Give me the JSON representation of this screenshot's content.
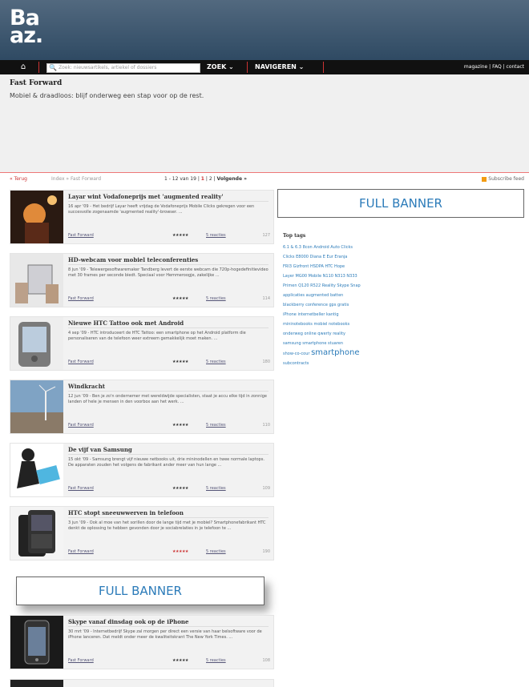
{
  "logo": {
    "line1": "Ba",
    "line2": "az."
  },
  "nav": {
    "search_placeholder": "Zoek: nieuwsartikels, artiekel of dossiers",
    "zoek_label": "ZOEK ⌄",
    "navigeren_label": "NAVIGEREN ⌄",
    "top_links": "magazine | FAQ | contact"
  },
  "intro": {
    "title": "Fast Forward",
    "subtitle": "Mobiel & draadloos: blijf onderweg een stap voor op de rest."
  },
  "crumbs": {
    "back": "« Terug",
    "path": "Index » Fast Forward",
    "pager_range": "1 - 12 van 19",
    "page1": "1",
    "page2": "2",
    "next": "Volgende »",
    "rss": "Subscribe feed"
  },
  "banners": {
    "right": "FULL BANNER",
    "mid": "FULL BANNER"
  },
  "articles": [
    {
      "title": "Layar wint Vodafoneprijs met 'augmented reality'",
      "desc": "16 apr '09 - Het bedrijf Layar heeft vrijdag de Vodafoneprijs Mobile Clicks gekregen voor een succesvolle zogenaamde 'augmented reality'-browser. ...",
      "tag": "Fast Forward",
      "stars": "★★★★★",
      "reactions": "5 reacties",
      "views": "127"
    },
    {
      "title": "HD-webcam voor mobiel teleconferenties",
      "desc": "8 jun '09 - Telewergesoftwaremaker Tandberg levert de eerste webcam die 720p-hogedefinitievideo met 30 frames per seconde biedt. Speciaal voor Hemmeroogje, zakelijke ...",
      "tag": "Fast Forward",
      "stars": "★★★★★",
      "reactions": "5 reacties",
      "views": "114"
    },
    {
      "title": "Nieuwe HTC Tattoo ook met Android",
      "desc": "4 sep '09 - HTC introduceert de HTC Tattoo: een smartphone op het Android platform die personaliseren van de telefoon weer extreem gemakkelijk moet maken. ...",
      "tag": "Fast Forward",
      "stars": "★★★★★",
      "reactions": "5 reacties",
      "views": "180"
    },
    {
      "title": "Windkracht",
      "desc": "12 jun '09 - Ben je zo'n ondernemer met wereldwijde specialisten, staat je accu elke tijd in zonnige landen of hele je mensen in den voorbox aan het werk. ...",
      "tag": "Fast Forward",
      "stars": "★★★★★",
      "reactions": "5 reacties",
      "views": "110"
    },
    {
      "title": "De vijf van Samsung",
      "desc": "15 okt '09 - Samsung brengt vijf nieuwe netbooks uit, drie mininodellen en twee normale laptops. De apparaten zouden het volgens de fabrikant ander meer van hun lange ...",
      "tag": "Fast Forward",
      "stars": "★★★★★",
      "reactions": "5 reacties",
      "views": "109"
    },
    {
      "title": "HTC stopt sneeuwwerven in telefoon",
      "desc": "3 jun '09 - Ook al moe van het sorillen door de lange tijd met je mobiel? Smartphonefabrikant HTC denkt de oplossing te hebben gevonden door je sociabrelaties in je telefoon te ...",
      "tag": "Fast Forward",
      "stars": "★★★★★",
      "reactions": "5 reacties",
      "views": "190"
    },
    {
      "title": "Skype vanaf dinsdag ook op de iPhone",
      "desc": "30 mrt '09 - Internetbedrijf Skype zal morgen per direct een versie van haar belsoftware voor de iPhone lanceren. Dat meldt onder meer de kwaliteitskrant The New York Times. ...",
      "tag": "Fast Forward",
      "stars": "★★★★★",
      "reactions": "5 reacties",
      "views": "108"
    }
  ],
  "top_tags": {
    "title": "Top tags",
    "lines": [
      "6.1 & 6.3  8con  Android  Auto  Clicks",
      "Clicks  E8000  Diana  E  Eur  Eranja",
      "FRI3  Gizfront  HSDPA  HTC  Hope",
      "Layer  MG00  Mobile  N110  N313  N333",
      "Primen  Q120  R522  Reality  Skype  Snap",
      "applicaties  augmented  batten",
      "blackberry  conference  gps  gratis",
      "iPhone  internetbeller  kantig",
      "mininotebooks  mobiel  notebooks",
      "onderweg  online  qwerty  reality",
      "samsung  smartphone  stuaren"
    ],
    "last_small": "show-co-cour",
    "last_big": "smartphone",
    "tail": "subcontracts"
  }
}
